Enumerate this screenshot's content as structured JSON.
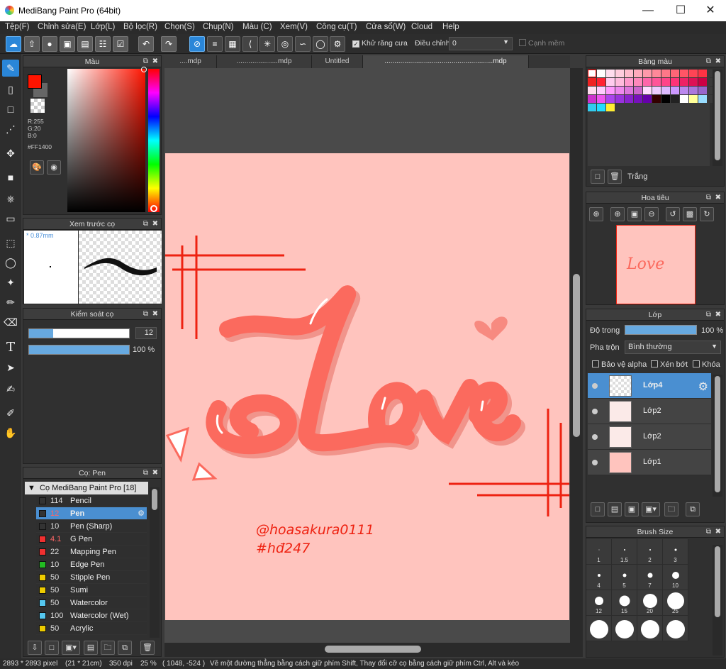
{
  "window": {
    "title": "MediBang Paint Pro (64bit)"
  },
  "menu": [
    "Tệp(F)",
    "Chỉnh sửa(E)",
    "Lớp(L)",
    "Bộ lọc(R)",
    "Chọn(S)",
    "Chụp(N)",
    "Màu (C)",
    "Xem(V)",
    "Công cụ(T)",
    "Cửa sổ(W)",
    "Cloud",
    "Help"
  ],
  "toolbar": {
    "antialias_label": "Khử răng cưa",
    "adjust_label": "Điều chỉnh",
    "adjust_value": "0",
    "edge_label": "Cạnh mềm"
  },
  "tabs": [
    "....mdp",
    ".....................mdp",
    "Untitled",
    ".......................................................mdp"
  ],
  "color_panel": {
    "title": "Màu",
    "r": "R:255",
    "g": "G:20",
    "b": "B:0",
    "hex": "#FF1400",
    "main_color": "#FF1400"
  },
  "brush_preview": {
    "title": "Xem trước cọ",
    "size": "* 0.87mm"
  },
  "brush_control": {
    "title": "Kiểm soát cọ",
    "size_value": "12",
    "opacity_value": "100 %"
  },
  "brush_panel": {
    "title": "Cọ: Pen",
    "group": "Cọ MediBang Paint Pro [18]",
    "items": [
      {
        "size": "114",
        "name": "Pencil",
        "color": "#333333"
      },
      {
        "size": "12",
        "name": "Pen",
        "color": "#333333"
      },
      {
        "size": "10",
        "name": "Pen (Sharp)",
        "color": "#333333"
      },
      {
        "size": "4.1",
        "name": "G Pen",
        "color": "#f03030"
      },
      {
        "size": "22",
        "name": "Mapping Pen",
        "color": "#f03030"
      },
      {
        "size": "10",
        "name": "Edge Pen",
        "color": "#22bb22"
      },
      {
        "size": "50",
        "name": "Stipple Pen",
        "color": "#eecc00"
      },
      {
        "size": "50",
        "name": "Sumi",
        "color": "#eecc00"
      },
      {
        "size": "50",
        "name": "Watercolor",
        "color": "#55c8f0"
      },
      {
        "size": "100",
        "name": "Watercolor (Wet)",
        "color": "#55c8f0"
      },
      {
        "size": "50",
        "name": "Acrylic",
        "color": "#eecc00"
      }
    ]
  },
  "palette": {
    "title": "Bảng màu",
    "name": "Trắng"
  },
  "navigator": {
    "title": "Hoa tiêu"
  },
  "layers": {
    "title": "Lớp",
    "opacity_label": "Độ trong",
    "opacity_value": "100 %",
    "blend_label": "Pha trộn",
    "blend_value": "Bình thường",
    "protect_alpha": "Bảo vệ alpha",
    "clipping": "Xén bớt",
    "lock": "Khóa",
    "items": [
      {
        "name": "Lớp4"
      },
      {
        "name": "Lớp2"
      },
      {
        "name": "Lớp2"
      },
      {
        "name": "Lớp1"
      }
    ]
  },
  "brush_size": {
    "title": "Brush Size",
    "sizes": [
      "1",
      "1.5",
      "2",
      "3",
      "4",
      "5",
      "7",
      "10",
      "12",
      "15",
      "20",
      "25"
    ]
  },
  "canvas": {
    "word": "Love",
    "credit1": "@hoasakura0111",
    "credit2": "#hđ247",
    "paper_color": "#FFC4BE"
  },
  "status": {
    "size": "2893 * 2893 pixel",
    "cm": "(21 * 21cm)",
    "dpi": "350 dpi",
    "zoom": "25 %",
    "coords": "( 1048, -524 )",
    "hint": "Vẽ một đường thẳng bằng cách giữ phím Shift, Thay đổi cỡ cọ bằng cách giữ phím Ctrl, Alt và kéo"
  }
}
